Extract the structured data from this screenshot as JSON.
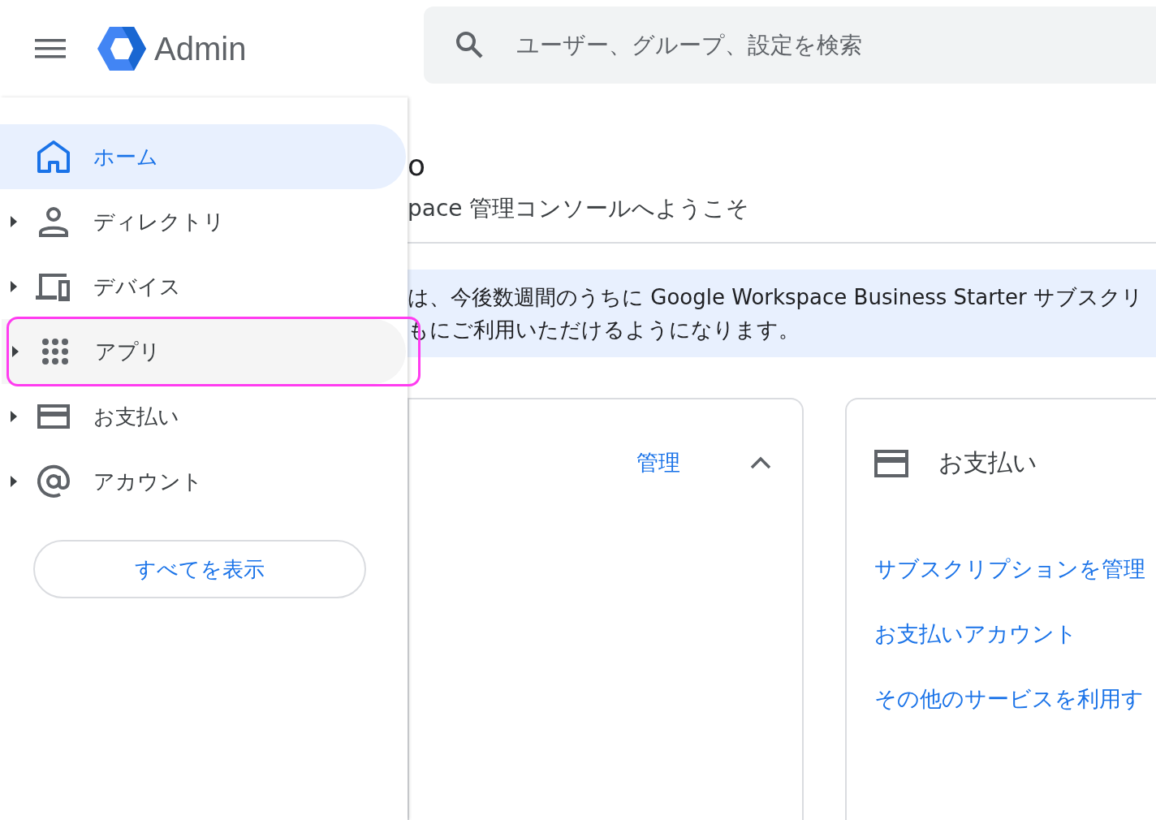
{
  "header": {
    "app_name": "Admin"
  },
  "search": {
    "placeholder": "ユーザー、グループ、設定を検索"
  },
  "nav": {
    "items": [
      {
        "label": "ホーム",
        "selected": true,
        "has_children": false,
        "hovered": false,
        "highlighted": false
      },
      {
        "label": "ディレクトリ",
        "selected": false,
        "has_children": true,
        "hovered": false,
        "highlighted": false
      },
      {
        "label": "デバイス",
        "selected": false,
        "has_children": true,
        "hovered": false,
        "highlighted": false
      },
      {
        "label": "アプリ",
        "selected": false,
        "has_children": true,
        "hovered": true,
        "highlighted": true
      },
      {
        "label": "お支払い",
        "selected": false,
        "has_children": true,
        "hovered": false,
        "highlighted": false
      },
      {
        "label": "アカウント",
        "selected": false,
        "has_children": true,
        "hovered": false,
        "highlighted": false
      }
    ],
    "show_all_button": "すべてを表示"
  },
  "main": {
    "greeting": "o",
    "subtitle": "pace 管理コンソールへようこそ",
    "banner": [
      "は、今後数週間のうちに Google Workspace Business Starter サブスクリ",
      "もにご利用いただけるようになります。"
    ],
    "cards": [
      {
        "action_link": "管理",
        "expanded": true
      },
      {
        "title": "お支払い",
        "links": [
          "サブスクリプションを管理",
          "お支払いアカウント",
          "その他のサービスを利用す"
        ]
      }
    ]
  }
}
